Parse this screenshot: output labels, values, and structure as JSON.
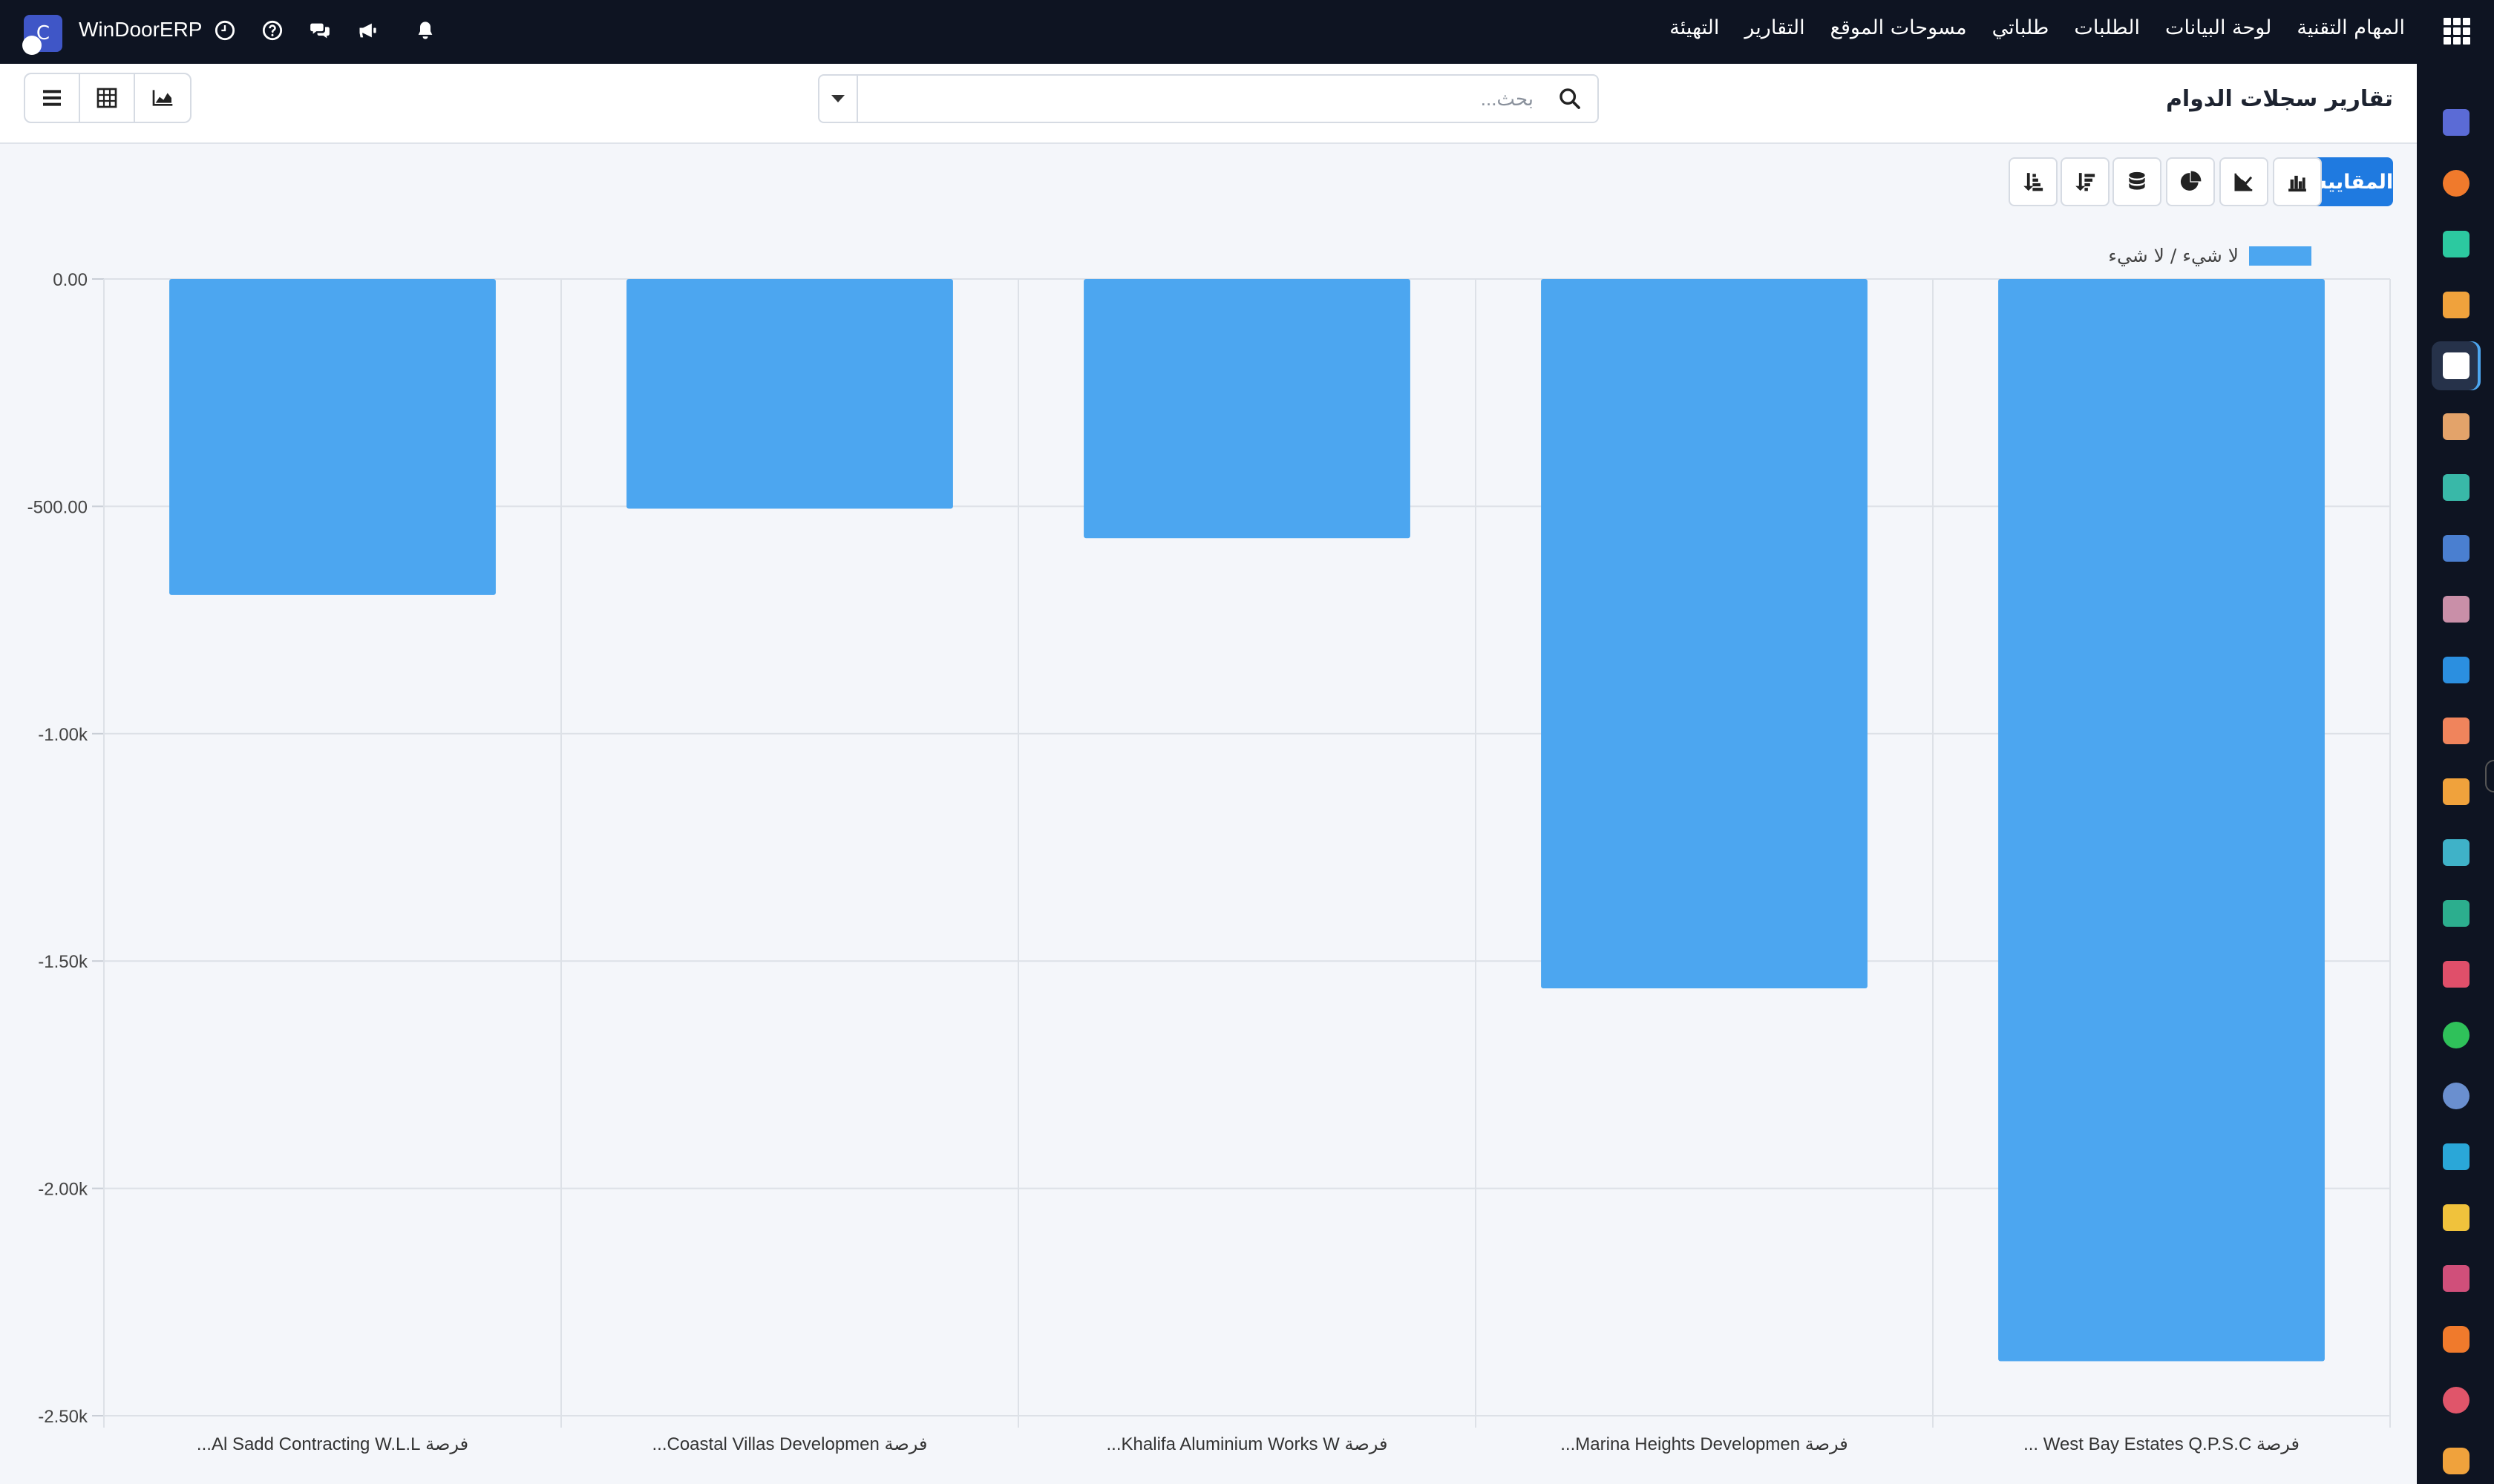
{
  "navbar": {
    "brand": "WinDoorERP",
    "logo_letter": "C",
    "menu": [
      "المهام التقنية",
      "لوحة البيانات",
      "الطلبات",
      "طلباتي",
      "مسوحات الموقع",
      "التقارير",
      "التهيئة"
    ],
    "system_icons": [
      "bell-icon",
      "megaphone-icon",
      "chat-icon",
      "help-icon",
      "clock-icon"
    ]
  },
  "control_panel": {
    "title": "تقارير سجلات الدوام",
    "search_placeholder": "بحث...",
    "views": [
      "list-view",
      "pivot-view",
      "graph-view"
    ]
  },
  "graph_toolbar": {
    "measures_label": "المقاييس",
    "chart_types": [
      "bar-chart",
      "line-chart",
      "pie-chart",
      "stacked"
    ],
    "sort": [
      "descending",
      "ascending"
    ]
  },
  "chart_data": {
    "type": "bar",
    "legend_label": "لا شيء / لا شيء",
    "categories": [
      "فرصة Al Sadd Contracting W.L.L...",
      "فرصة Coastal Villas Developmen...",
      "فرصة Khalifa Aluminium Works W...",
      "فرصة Marina Heights Developmen...",
      "فرصة West Bay Estates Q.P.S.C ..."
    ],
    "series": [
      {
        "name": "لا شيء / لا شيء",
        "values": [
          -695,
          -505,
          -570,
          -1560,
          -2380
        ]
      }
    ],
    "ylim": [
      -2500,
      0
    ],
    "y_ticks": [
      0,
      -500,
      -1000,
      -1500,
      -2000,
      -2500
    ],
    "y_tick_labels": [
      "0.00",
      "-500.00",
      "-1.00k",
      "-1.50k",
      "-2.00k",
      "-2.50k"
    ],
    "grid": true,
    "legend_position": "top-right",
    "bar_color": "#4ca6f0"
  },
  "sidebar": {
    "apps": [
      {
        "name": "app-m",
        "color": "#5b6bd6"
      },
      {
        "name": "app-chat",
        "color": "#f07a2c"
      },
      {
        "name": "app-check",
        "color": "#2cc9a0"
      },
      {
        "name": "app-bars",
        "color": "#f0a23c"
      },
      {
        "name": "app-box",
        "color": "#ffffff"
      },
      {
        "name": "app-contacts",
        "color": "#e3a36a"
      },
      {
        "name": "app-tasks",
        "color": "#39b8a8"
      },
      {
        "name": "app-book",
        "color": "#4a7fd0"
      },
      {
        "name": "app-package",
        "color": "#c98fa8"
      },
      {
        "name": "app-invoice",
        "color": "#2b8fe0"
      },
      {
        "name": "app-team",
        "color": "#f0845c"
      },
      {
        "name": "app-calendar",
        "color": "#f0a23c"
      },
      {
        "name": "app-sign",
        "color": "#3fb2c8"
      },
      {
        "name": "app-employees",
        "color": "#2cae8e"
      },
      {
        "name": "app-dashboard",
        "color": "#e04f6a"
      },
      {
        "name": "app-whatsapp",
        "color": "#2fc15a"
      },
      {
        "name": "app-compass",
        "color": "#6a8fcf"
      },
      {
        "name": "app-wave",
        "color": "#2aa7d8"
      },
      {
        "name": "app-send",
        "color": "#f0c23c"
      },
      {
        "name": "app-layers",
        "color": "#d04f7a"
      },
      {
        "name": "app-hex",
        "color": "#f07a2c"
      },
      {
        "name": "app-pie",
        "color": "#e0556a"
      },
      {
        "name": "app-hexagon",
        "color": "#f0a23c"
      }
    ]
  }
}
